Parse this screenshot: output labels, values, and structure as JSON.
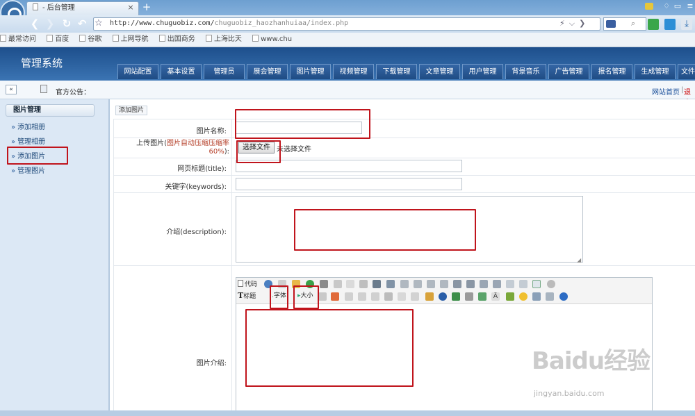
{
  "browser": {
    "tab_title": "- 后台管理",
    "tab_close": "×",
    "new_tab": "+",
    "url_host": "http://www.chuguobiz.com/",
    "url_path": "chuguobiz_haozhanhuiaa/index.php",
    "bookmarks": [
      "最常访问",
      "百度",
      "谷歌",
      "上网导航",
      "出国商务",
      "上海比天",
      "www.chu"
    ]
  },
  "app": {
    "title": "管理系统",
    "top_nav": [
      "网站配置",
      "基本设置",
      "管理员",
      "展会管理",
      "图片管理",
      "视频管理",
      "下载管理",
      "文章管理",
      "用户管理",
      "背景音乐",
      "广告管理",
      "报名管理",
      "生成管理",
      "文件管"
    ],
    "collapse_glyph": "«",
    "notice_label": "官方公告：",
    "site_home": "网站首页",
    "logout": "退出"
  },
  "sidebar": {
    "heading": "图片管理",
    "arrow": "»",
    "items": [
      "添加相册",
      "管理相册",
      "添加图片",
      "管理图片"
    ]
  },
  "form": {
    "tab_label": "添加图片",
    "name_label": "图片名称:",
    "upload_label_prefix": "上传图片(",
    "upload_label_note": "图片自动压缩压缩率60%",
    "upload_label_suffix": "):",
    "file_button": "选择文件",
    "file_status": "未选择文件",
    "title_label": "网页标题(title):",
    "keywords_label": "关键字(keywords):",
    "description_label": "介绍(description):",
    "intro_label": "图片介绍:"
  },
  "editor": {
    "code_button": "代码",
    "title_button": "标题",
    "font_button": "字体",
    "size_button": "大小"
  },
  "watermark": {
    "logo": "Baidu经验",
    "url": "jingyan.baidu.com"
  },
  "colors": {
    "header_blue": "#2a5f9e",
    "annotation_red": "#c0141c",
    "sidebar_bg": "#dce8f5",
    "upload_note": "#b5402a"
  }
}
